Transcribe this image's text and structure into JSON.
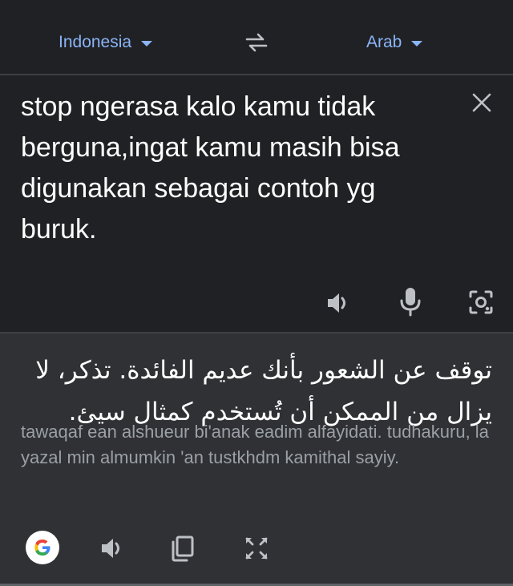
{
  "languages": {
    "source": "Indonesia",
    "target": "Arab"
  },
  "input": {
    "text": "stop ngerasa kalo kamu tidak berguna,ingat kamu masih bisa digunakan sebagai contoh yg buruk."
  },
  "output": {
    "translation": "توقف عن الشعور بأنك عديم الفائدة. تذكر، لا يزال من الممكن أن تُستخدم كمثال سيئ.",
    "transliteration": "tawaqaf ean alshueur bi'anak eadim alfayidati. tudhakuru, la yazal min almumkin 'an tustkhdm kamithal sayiy."
  },
  "colors": {
    "background": "#202124",
    "output_background": "#303134",
    "accent": "#8ab4f8",
    "icon": "#bdc1c6",
    "transliteration": "#9aa0a6"
  },
  "icons": {
    "caret": "caret-down-icon",
    "swap": "swap-icon",
    "clear": "close-icon",
    "speaker": "speaker-icon",
    "mic": "mic-icon",
    "camera": "camera-icon",
    "google": "google-icon",
    "copy": "copy-icon",
    "fullscreen": "fullscreen-icon"
  }
}
